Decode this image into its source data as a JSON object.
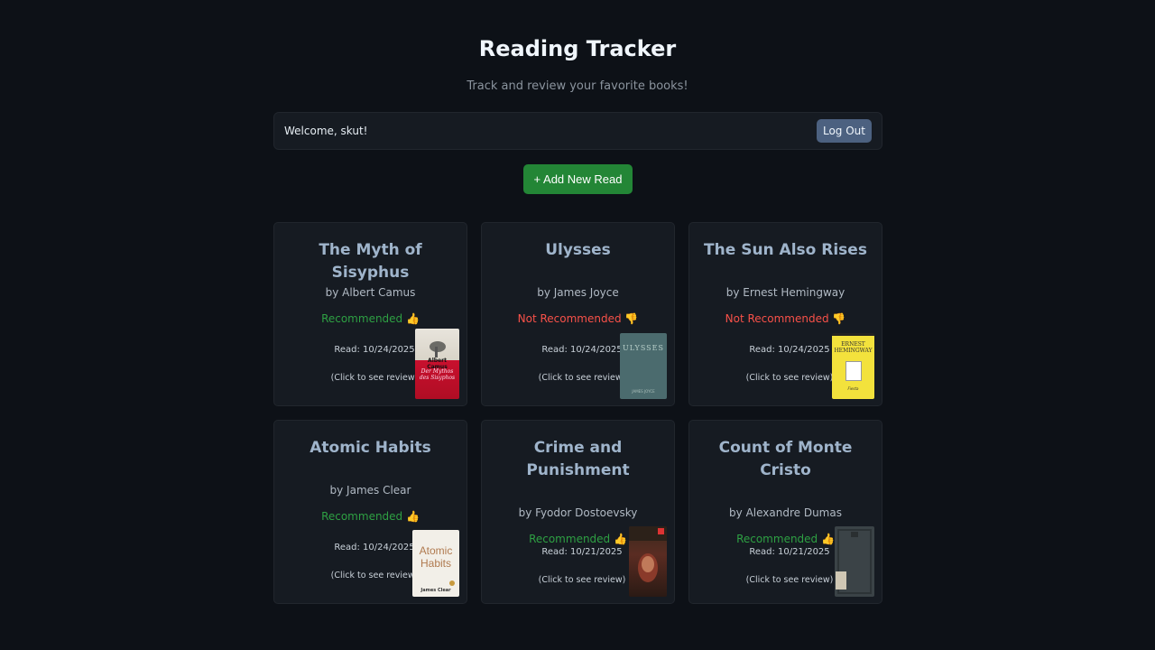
{
  "header": {
    "title": "Reading Tracker",
    "subtitle": "Track and review your favorite books!"
  },
  "userbar": {
    "welcome": "Welcome, skut!",
    "logout_label": "Log Out"
  },
  "add_button_label": "+ Add New Read",
  "books": [
    {
      "title": "The Myth of Sisyphus",
      "author": "by Albert Camus",
      "rec_label": "Recommended 👍",
      "recommended": true,
      "read": "Read: 10/24/2025",
      "hint": "(Click to see review)",
      "cover_top": "Albert Camus",
      "cover_bottom": "Der Mythos des Sisyphos"
    },
    {
      "title": "Ulysses",
      "author": "by James Joyce",
      "rec_label": "Not Recommended 👎",
      "recommended": false,
      "read": "Read: 10/24/2025",
      "hint": "(Click to see review)",
      "cover_top": "ULYSSES",
      "cover_bottom": "JAMES JOYCE"
    },
    {
      "title": "The Sun Also Rises",
      "author": "by Ernest Hemingway",
      "rec_label": "Not Recommended 👎",
      "recommended": false,
      "read": "Read: 10/24/2025",
      "hint": "(Click to see review)",
      "cover_top": "ERNEST HEMINGWAY",
      "cover_bottom": "Fiesta"
    },
    {
      "title": "Atomic Habits",
      "author": "by James Clear",
      "rec_label": "Recommended 👍",
      "recommended": true,
      "read": "Read: 10/24/2025",
      "hint": "(Click to see review)",
      "cover_top": "Atomic Habits",
      "cover_bottom": "James Clear"
    },
    {
      "title": "Crime and Punishment",
      "author": "by Fyodor Dostoevsky",
      "rec_label": "Recommended 👍",
      "recommended": true,
      "read": "Read: 10/21/2025",
      "hint": "(Click to see review)",
      "cover_top": "",
      "cover_bottom": ""
    },
    {
      "title": "Count of Monte Cristo",
      "author": "by Alexandre Dumas",
      "rec_label": "Recommended 👍",
      "recommended": true,
      "read": "Read: 10/21/2025",
      "hint": "(Click to see review)",
      "cover_top": "",
      "cover_bottom": ""
    }
  ],
  "colors": {
    "background": "#0d1117",
    "card": "#161b22",
    "recommended": "#2ea043",
    "not_recommended": "#f85149",
    "add_button": "#238636",
    "logout_button": "#4c6180"
  }
}
